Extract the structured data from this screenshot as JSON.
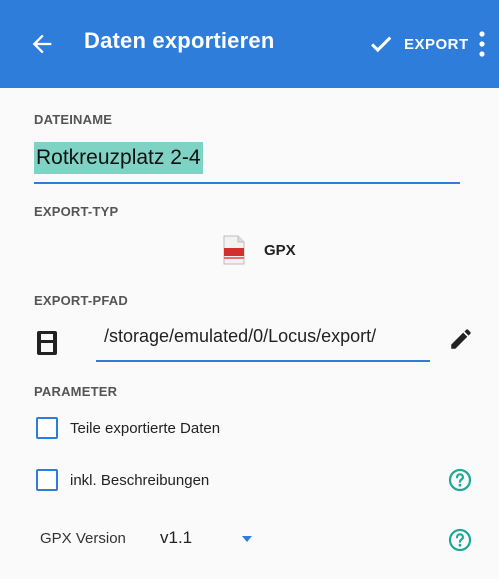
{
  "appbar": {
    "title": "Daten exportieren",
    "export_label": "EXPORT",
    "back_icon": "arrow-left-icon",
    "check_icon": "check-icon",
    "more_icon": "more-vert-icon",
    "color": "#2f7ddb"
  },
  "filename": {
    "label": "DATEINAME",
    "value": "Rotkreuzplatz 2-4"
  },
  "export_type": {
    "label": "EXPORT-TYP",
    "value": "GPX",
    "icon": "gpx-file-icon"
  },
  "export_path": {
    "label": "EXPORT-PFAD",
    "value": "/storage/emulated/0/Locus/export/",
    "storage_icon": "sd-card-icon",
    "edit_icon": "pencil-icon"
  },
  "parameters": {
    "label": "PARAMETER",
    "share_label": "Teile exportierte Daten",
    "share_checked": false,
    "descriptions_label": "inkl. Beschreibungen",
    "descriptions_checked": false,
    "gpx_version_label": "GPX Version",
    "gpx_version_value": "v1.1",
    "help_icon": "help-circle-icon"
  }
}
